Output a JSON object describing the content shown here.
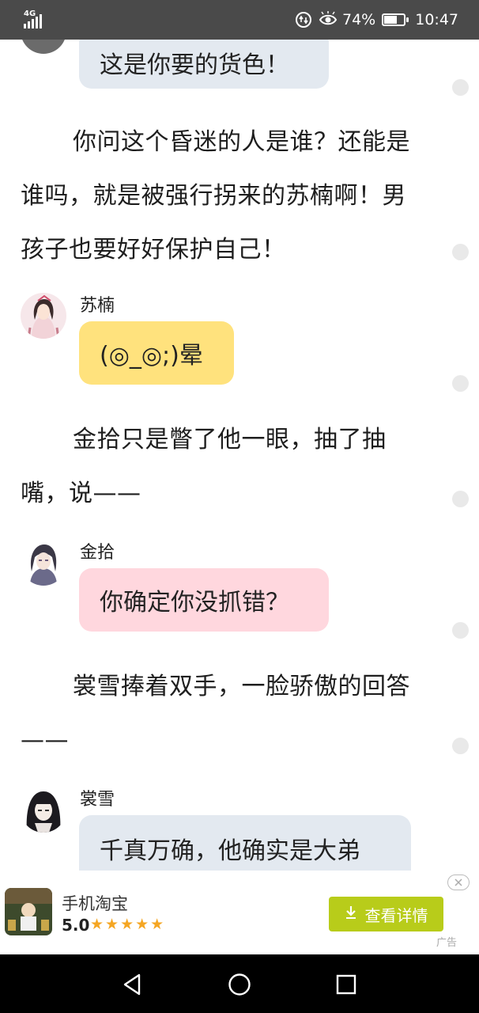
{
  "status_bar": {
    "network": "4G",
    "battery": "74%",
    "battery_level": 0.74,
    "time": "10:47"
  },
  "story": {
    "bubble_top_text": "这是你要的货色！",
    "para1": "你问这个昏迷的人是谁？还能是谁吗，就是被强行拐来的苏楠啊！男孩子也要好好保护自己！",
    "msg1_speaker": "苏楠",
    "msg1_text": "(◎_◎;)晕",
    "para2": "金拾只是瞥了他一眼，抽了抽嘴，说——",
    "msg2_speaker": "金拾",
    "msg2_text": "你确定你没抓错？",
    "para3": "裳雪捧着双手，一脸骄傲的回答——",
    "msg3_speaker": "裳雪",
    "msg3_text": "千真万确，他确实是大弟"
  },
  "ad": {
    "app_name": "手机淘宝",
    "rating": "5.0",
    "stars": "★★★★★",
    "button_label": "查看详情",
    "tag": "广告"
  },
  "icons": {
    "back": "triangle-back-icon",
    "home": "circle-home-icon",
    "recents": "square-recents-icon"
  }
}
